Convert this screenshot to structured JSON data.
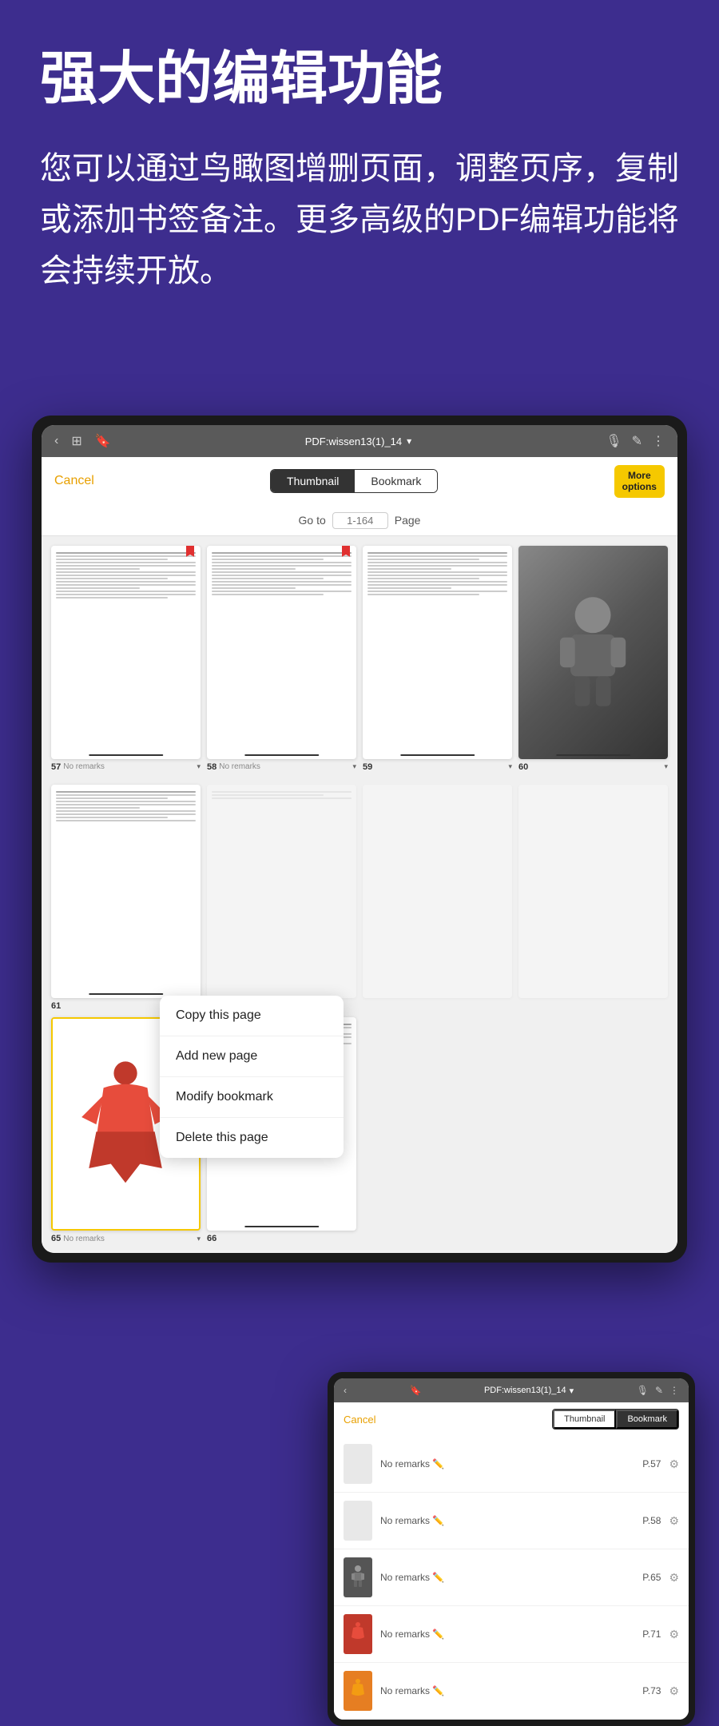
{
  "hero": {
    "title": "强大的编辑功能",
    "description": "您可以通过鸟瞰图增删页面，调整页序，复制或添加书签备注。更多高级的PDF编辑功能将会持续开放。"
  },
  "tablet_main": {
    "topbar": {
      "filename": "PDF:wissen13(1)_14",
      "dropdown_icon": "▾"
    },
    "controls": {
      "cancel_label": "Cancel",
      "tab_thumbnail": "Thumbnail",
      "tab_bookmark": "Bookmark",
      "more_options_label": "More\noptions"
    },
    "page_nav": {
      "goto_label": "Go to",
      "page_range": "1-164",
      "page_label": "Page"
    },
    "thumbnails_row1": [
      {
        "page": "57",
        "remarks": "No remarks",
        "has_bookmark": true
      },
      {
        "page": "58",
        "remarks": "No remarks",
        "has_bookmark": true
      },
      {
        "page": "59",
        "remarks": "",
        "has_figure": false
      },
      {
        "page": "60",
        "remarks": "",
        "has_dark_figure": true
      }
    ],
    "thumbnails_row2": [
      {
        "page": "61",
        "remarks": "",
        "has_figure": false
      },
      {
        "page": "",
        "remarks": "",
        "hidden": true
      },
      {
        "page": "",
        "remarks": "",
        "hidden": true
      },
      {
        "page": "",
        "remarks": "",
        "hidden": true
      }
    ],
    "thumbnails_row3": [
      {
        "page": "65",
        "remarks": "No remarks",
        "has_colored_figure": true,
        "highlighted": true
      },
      {
        "page": "66",
        "remarks": ""
      }
    ],
    "context_menu": {
      "items": [
        "Copy this page",
        "Add new page",
        "Modify bookmark",
        "Delete this page"
      ]
    }
  },
  "tablet_secondary": {
    "topbar": {
      "filename": "PDF:wissen13(1)_14",
      "dropdown_icon": "▾"
    },
    "controls": {
      "cancel_label": "Cancel",
      "tab_thumbnail": "Thumbnail",
      "tab_bookmark": "Bookmark"
    },
    "bookmark_list": [
      {
        "page": "P.57",
        "remarks": "No remarks",
        "has_figure": false
      },
      {
        "page": "P.58",
        "remarks": "No remarks",
        "has_figure": false
      },
      {
        "page": "P.65",
        "remarks": "No remarks",
        "has_figure": true,
        "figure_type": "dark"
      },
      {
        "page": "P.71",
        "remarks": "No remarks",
        "has_figure": true,
        "figure_type": "red"
      },
      {
        "page": "P.73",
        "remarks": "No remarks",
        "has_figure": true,
        "figure_type": "orange"
      }
    ]
  }
}
